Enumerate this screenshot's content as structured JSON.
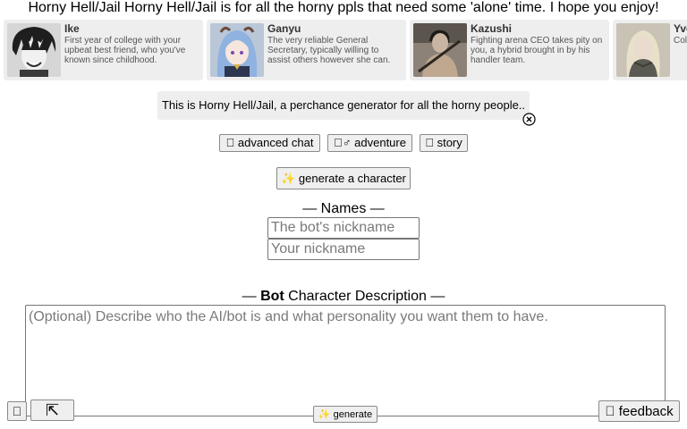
{
  "banner_text": "Horny Hell/Jail Horny Hell/Jail is for all the horny ppls that need some 'alone' time. I hope you enjoy!",
  "characters": [
    {
      "name": "Ike",
      "description": "First year of college with your upbeat best friend, who you've known since childhood."
    },
    {
      "name": "Ganyu",
      "description": "The very reliable General Secretary, typically willing to assist others however she can."
    },
    {
      "name": "Kazushi",
      "description": "Fighting arena CEO takes pity on you, a hybrid brought in by his handler team."
    },
    {
      "name": "Yve",
      "description": "Col... ma... und..."
    }
  ],
  "notice": {
    "text": "This is Horny Hell/Jail, a perchance generator for all the horny people.."
  },
  "modes": [
    {
      "label": "\u0000 advanced chat"
    },
    {
      "label": "\u0000♂ adventure"
    },
    {
      "label": "\u0000 story"
    }
  ],
  "generate_character_label": "✨ generate a character",
  "names_heading": "— Names —",
  "bot_nickname_placeholder": "The bot's nickname",
  "user_nickname_placeholder": "Your nickname",
  "desc_heading": {
    "prefix": "— ",
    "bold": "Bot",
    "rest": " Character Description —"
  },
  "desc_placeholder": "(Optional) Describe who the AI/bot is and what personality you want them to have.",
  "bottom": {
    "left_icon_label": "\u0000",
    "expand_label": "⇱",
    "generate_label": "✨ generate",
    "feedback_label": "\u0000 feedback"
  }
}
